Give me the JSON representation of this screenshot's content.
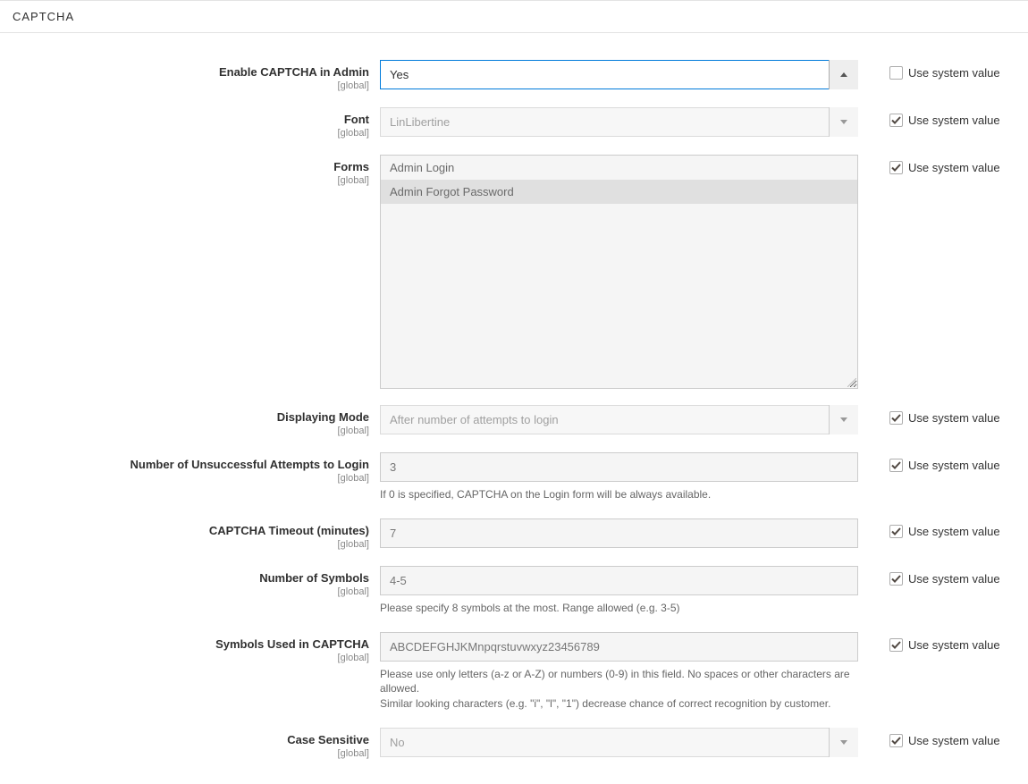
{
  "section": {
    "title": "CAPTCHA"
  },
  "scopeLabel": "[global]",
  "useSystemValueLabel": "Use system value",
  "fields": {
    "enable": {
      "label": "Enable CAPTCHA in Admin",
      "value": "Yes",
      "useSystem": false
    },
    "font": {
      "label": "Font",
      "value": "LinLibertine",
      "useSystem": true
    },
    "forms": {
      "label": "Forms",
      "options": {
        "o0": "Admin Login",
        "o1": "Admin Forgot Password"
      },
      "useSystem": true
    },
    "mode": {
      "label": "Displaying Mode",
      "value": "After number of attempts to login",
      "useSystem": true
    },
    "attempts": {
      "label": "Number of Unsuccessful Attempts to Login",
      "value": "3",
      "note": "If 0 is specified, CAPTCHA on the Login form will be always available.",
      "useSystem": true
    },
    "timeout": {
      "label": "CAPTCHA Timeout (minutes)",
      "value": "7",
      "useSystem": true
    },
    "symbolsCount": {
      "label": "Number of Symbols",
      "value": "4-5",
      "note": "Please specify 8 symbols at the most. Range allowed (e.g. 3-5)",
      "useSystem": true
    },
    "symbolsUsed": {
      "label": "Symbols Used in CAPTCHA",
      "value": "ABCDEFGHJKMnpqrstuvwxyz23456789",
      "note1": "Please use only letters (a-z or A-Z) or numbers (0-9) in this field. No spaces or other characters are allowed.",
      "note2": "Similar looking characters (e.g. \"i\", \"l\", \"1\") decrease chance of correct recognition by customer.",
      "useSystem": true
    },
    "caseSensitive": {
      "label": "Case Sensitive",
      "value": "No",
      "useSystem": true
    }
  }
}
